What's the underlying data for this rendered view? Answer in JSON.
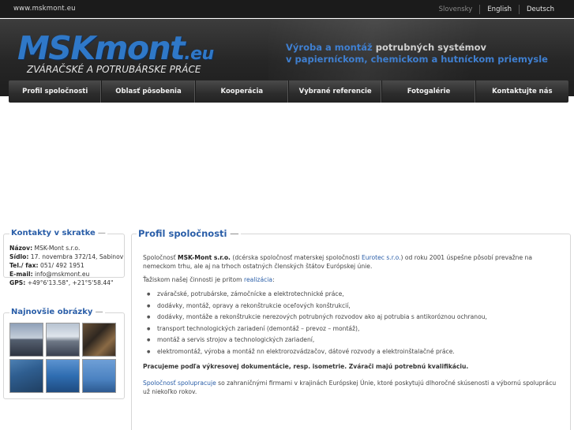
{
  "topbar": {
    "url": "www.mskmont.eu",
    "languages": [
      "Slovensky",
      "English",
      "Deutsch"
    ]
  },
  "header": {
    "logo_main": "MSKmont",
    "logo_suffix": ".eu",
    "logo_subtitle": "ZVÁRAČSKÉ A POTRUBÁRSKE PRÁCE",
    "tagline_line1_highlight": "Výroba a montáž",
    "tagline_line1_rest": " potrubných systémov",
    "tagline_line2": "v papierníckom, chemickom a hutníckom priemysle"
  },
  "nav": {
    "items": [
      "Profil spoločnosti",
      "Oblasť pôsobenia",
      "Kooperácia",
      "Vybrané referencie",
      "Fotogalérie",
      "Kontaktujte nás"
    ]
  },
  "sidebar": {
    "contacts_title": "Kontakty v skratke",
    "contacts": [
      {
        "label": "Názov:",
        "value": " MSK-Mont s.r.o."
      },
      {
        "label": "Sídlo:",
        "value": " 17. novembra 372/14, Sabinov"
      },
      {
        "label": "Tel./ fax:",
        "value": " 051/ 492 1951"
      },
      {
        "label": "E-mail:",
        "value": " info@mskmont.eu"
      },
      {
        "label": "GPS:",
        "value": " +49°6'13.58\", +21°5'58.44\""
      }
    ],
    "pictures_title": "Najnovšie obrázky"
  },
  "main": {
    "title": "Profil spoločnosti",
    "intro_1": "Spoločnosť ",
    "intro_company": "MSK-Mont s.r.o.",
    "intro_2": " (dcérska spoločnosť materskej spoločnosti ",
    "intro_link": "Eurotec s.r.o.",
    "intro_3": ") od roku 2001 úspešne pôsobí prevažne na nemeckom trhu, ale aj na trhoch ostatných členských štátov Európskej únie.",
    "focus_1": "Ťažiskom našej činnosti je pritom ",
    "focus_link": "realizácia",
    "focus_2": ":",
    "bullets": [
      "zváračské, potrubárske, zámočnícke a elektrotechnické práce,",
      "dodávky, montáž, opravy a rekonštrukcie oceľových konštrukcií,",
      "dodávky, montáže a rekonštrukcie nerezových potrubných rozvodov ako aj potrubia s antikoróznou ochranou,",
      "transport technologických zariadení (demontáž – prevoz – montáž),",
      "montáž a servis strojov a technologických zariadení,",
      "elektromontáž, výroba a montáž nn elektrorozvádzačov, dátové rozvody a elektroinštalačné práce."
    ],
    "bold_statement": "Pracujeme podľa výkresovej dokumentácie, resp. isometrie. Zvárači majú potrebnú kvalifikáciu.",
    "coop_1": "Spoločnosť ",
    "coop_link": "spolupracuje",
    "coop_2": " so zahraničnými firmami v krajinách Európskej Únie, ktoré poskytujú dlhoročné skúsenosti a výbornú spoluprácu už niekoľko rokov."
  }
}
